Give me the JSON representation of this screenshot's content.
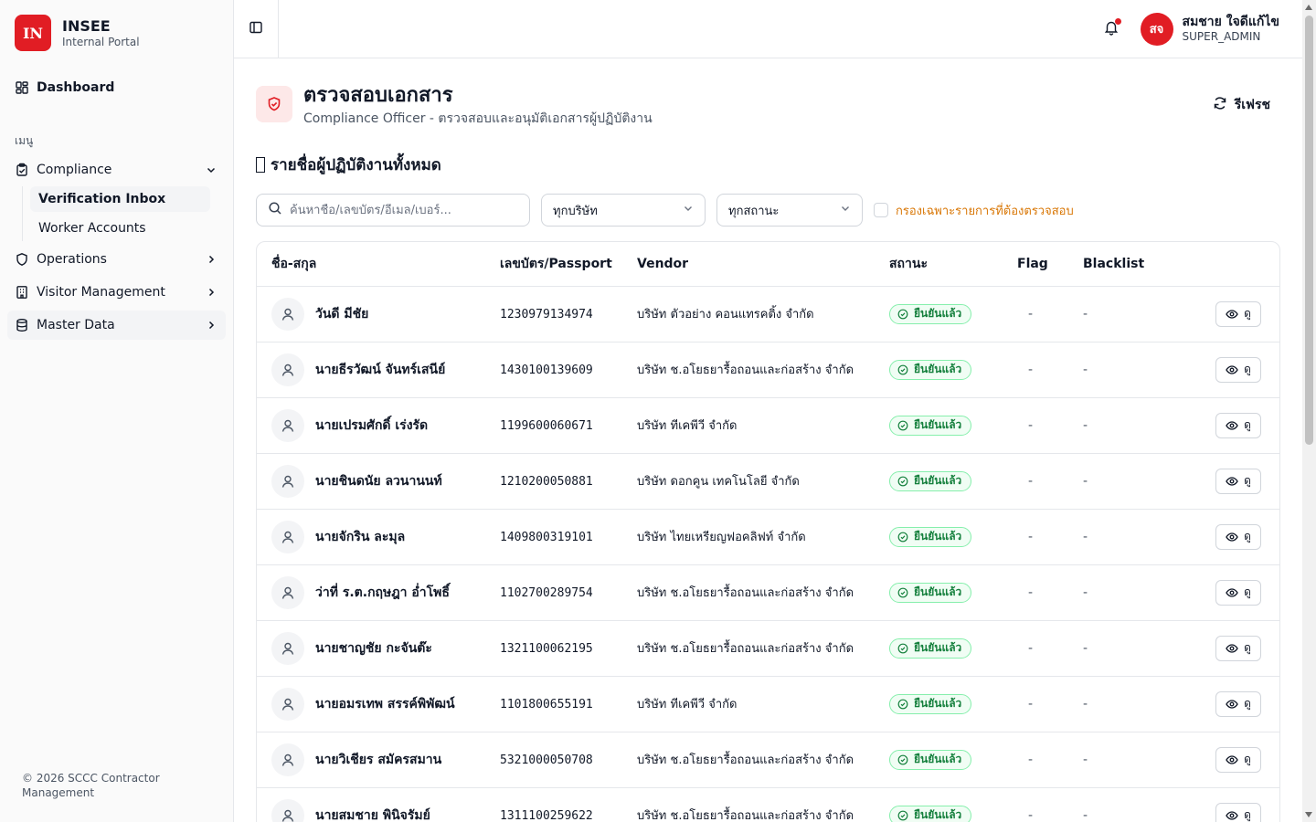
{
  "brand": {
    "logo": "IN",
    "name": "INSEE",
    "subtitle": "Internal Portal"
  },
  "sidebar": {
    "dashboard": "Dashboard",
    "section_label": "เมนู",
    "compliance": "Compliance",
    "sub_items": [
      "Verification Inbox",
      "Worker Accounts"
    ],
    "operations": "Operations",
    "visitor": "Visitor Management",
    "master_data": "Master Data",
    "footer": "© 2026 SCCC Contractor Management"
  },
  "user": {
    "initials": "สจ",
    "name": "สมชาย ใจดีแก้ไข",
    "role": "SUPER_ADMIN"
  },
  "page": {
    "title": "ตรวจสอบเอกสาร",
    "subtitle": "Compliance Officer - ตรวจสอบและอนุมัติเอกสารผู้ปฏิบัติงาน",
    "refresh": "รีเฟรช",
    "list_title": "รายชื่อผู้ปฏิบัติงานทั้งหมด"
  },
  "filters": {
    "search_placeholder": "ค้นหาชื่อ/เลขบัตร/อีเมล/เบอร์...",
    "company": "ทุกบริษัท",
    "status": "ทุกสถานะ",
    "pending_only": "กรองเฉพาะรายการที่ต้องตรวจสอบ"
  },
  "table": {
    "headers": {
      "name": "ชื่อ-สกุล",
      "id": "เลขบัตร/Passport",
      "vendor": "Vendor",
      "status": "สถานะ",
      "flag": "Flag",
      "blacklist": "Blacklist"
    },
    "view_label": "ดู",
    "rows": [
      {
        "name": "วันดี มีชัย",
        "id": "1230979134974",
        "vendor": "บริษัท ตัวอย่าง คอนแทรคติ้ง จำกัด",
        "status": "ยืนยันแล้ว",
        "flag": "-",
        "blacklist": "-"
      },
      {
        "name": "นายธีรวัฒน์ จันทร์เสนีย์",
        "id": "1430100139609",
        "vendor": "บริษัท ช.อโยธยารื้อถอนและก่อสร้าง จำกัด",
        "status": "ยืนยันแล้ว",
        "flag": "-",
        "blacklist": "-"
      },
      {
        "name": "นายเปรมศักดิ์ เร่งรัด",
        "id": "1199600060671",
        "vendor": "บริษัท ทีเคพีวี จำกัด",
        "status": "ยืนยันแล้ว",
        "flag": "-",
        "blacklist": "-"
      },
      {
        "name": "นายชินดนัย ลวนานนท์",
        "id": "1210200050881",
        "vendor": "บริษัท ดอกคูน เทคโนโลยี จำกัด",
        "status": "ยืนยันแล้ว",
        "flag": "-",
        "blacklist": "-"
      },
      {
        "name": "นายจักริน ละมุล",
        "id": "1409800319101",
        "vendor": "บริษัท ไทยเหรียญฟอคลิฟท์ จำกัด",
        "status": "ยืนยันแล้ว",
        "flag": "-",
        "blacklist": "-"
      },
      {
        "name": "ว่าที่ ร.ต.กฤษฎา อ่ำโพธิ์",
        "id": "1102700289754",
        "vendor": "บริษัท ช.อโยธยารื้อถอนและก่อสร้าง จำกัด",
        "status": "ยืนยันแล้ว",
        "flag": "-",
        "blacklist": "-"
      },
      {
        "name": "นายชาญชัย กะจันต๊ะ",
        "id": "1321100062195",
        "vendor": "บริษัท ช.อโยธยารื้อถอนและก่อสร้าง จำกัด",
        "status": "ยืนยันแล้ว",
        "flag": "-",
        "blacklist": "-"
      },
      {
        "name": "นายอมรเทพ สรรค์พิพัฒน์",
        "id": "1101800655191",
        "vendor": "บริษัท ทีเคพีวี จำกัด",
        "status": "ยืนยันแล้ว",
        "flag": "-",
        "blacklist": "-"
      },
      {
        "name": "นายวิเชียร สมัครสมาน",
        "id": "5321000050708",
        "vendor": "บริษัท ช.อโยธยารื้อถอนและก่อสร้าง จำกัด",
        "status": "ยืนยันแล้ว",
        "flag": "-",
        "blacklist": "-"
      },
      {
        "name": "นายสมชาย พินิจรัมย์",
        "id": "1311100259622",
        "vendor": "บริษัท ช.อโยธยารื้อถอนและก่อสร้าง จำกัด",
        "status": "ยืนยันแล้ว",
        "flag": "-",
        "blacklist": "-"
      }
    ]
  },
  "icons": {
    "dashboard": "dashboard-icon",
    "compliance": "clipboard-check-icon",
    "operations": "shield-icon",
    "visitor": "building-icon",
    "master": "database-icon",
    "toggle": "sidebar-toggle-icon",
    "bell": "bell-icon",
    "refresh": "refresh-icon",
    "search": "search-icon",
    "person": "user-icon",
    "eye": "eye-icon"
  },
  "colors": {
    "brand": "#e11d24",
    "success": "#15803d",
    "warning": "#d97706"
  }
}
